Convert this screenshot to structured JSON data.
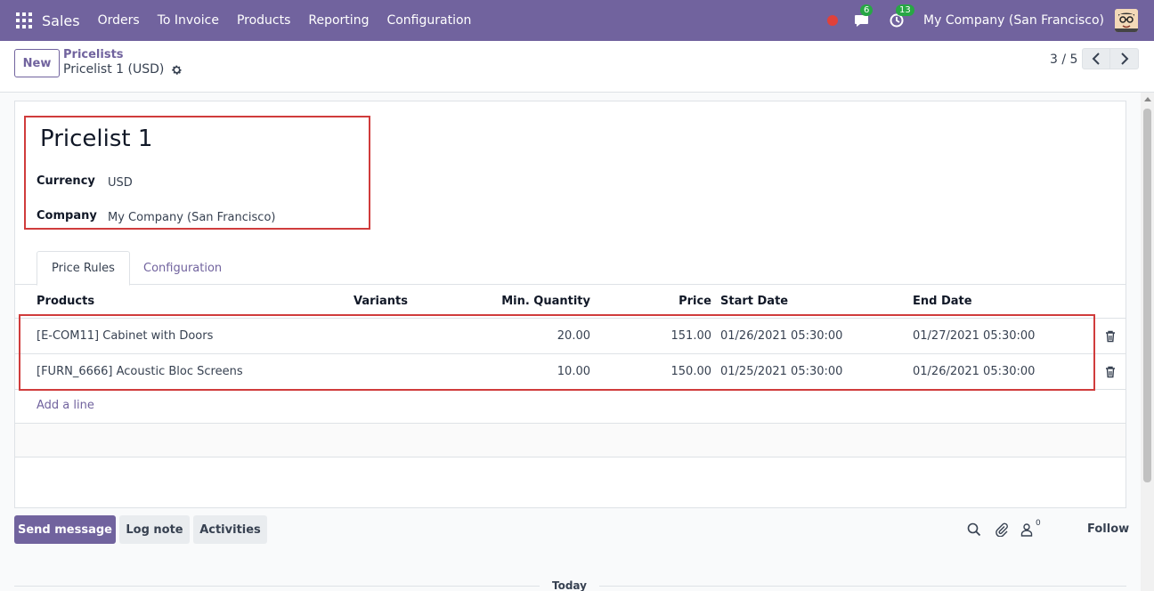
{
  "navbar": {
    "app_name": "Sales",
    "menu": [
      "Orders",
      "To Invoice",
      "Products",
      "Reporting",
      "Configuration"
    ],
    "messages_count": "6",
    "activities_count": "13",
    "company": "My Company (San Francisco)",
    "bg_color": "#71639e"
  },
  "control_panel": {
    "new_label": "New",
    "breadcrumb_parent": "Pricelists",
    "breadcrumb_current": "Pricelist 1 (USD)",
    "pager": "3 / 5"
  },
  "form": {
    "title": "Pricelist 1",
    "currency_label": "Currency",
    "currency_value": "USD",
    "company_label": "Company",
    "company_value": "My Company (San Francisco)"
  },
  "tabs": [
    "Price Rules",
    "Configuration"
  ],
  "table": {
    "headers": [
      "Products",
      "Variants",
      "Min. Quantity",
      "Price",
      "Start Date",
      "End Date"
    ],
    "rows": [
      {
        "product": "[E-COM11] Cabinet with Doors",
        "variants": "",
        "min_qty": "20.00",
        "price": "151.00",
        "start": "01/26/2021 05:30:00",
        "end": "01/27/2021 05:30:00"
      },
      {
        "product": "[FURN_6666] Acoustic Bloc Screens",
        "variants": "",
        "min_qty": "10.00",
        "price": "150.00",
        "start": "01/25/2021 05:30:00",
        "end": "01/26/2021 05:30:00"
      }
    ],
    "add_line": "Add a line"
  },
  "chatter": {
    "send_message": "Send message",
    "log_note": "Log note",
    "activities": "Activities",
    "follower_count": "0",
    "follow": "Follow",
    "today": "Today"
  },
  "colors": {
    "accent": "#71639e",
    "highlight": "#d03c3c"
  }
}
